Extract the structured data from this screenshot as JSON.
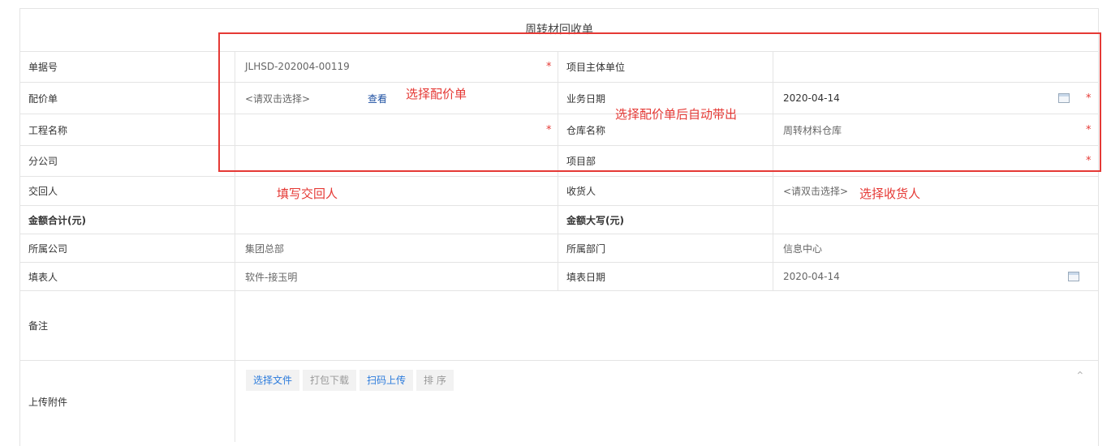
{
  "form_title": "周转材回收单",
  "rows": {
    "r1": {
      "l1": "单据号",
      "v1": "JLHSD-202004-00119",
      "l2": "项目主体单位",
      "v2": ""
    },
    "r2": {
      "l1": "配价单",
      "v1": "<请双击选择>",
      "link": "查看",
      "l2": "业务日期",
      "v2": "2020-04-14"
    },
    "r3": {
      "l1": "工程名称",
      "v1": "",
      "l2": "仓库名称",
      "v2": "周转材料仓库"
    },
    "r4": {
      "l1": "分公司",
      "v1": "",
      "l2": "项目部",
      "v2": ""
    },
    "r5": {
      "l1": "交回人",
      "v1": "",
      "l2": "收货人",
      "v2": "<请双击选择>"
    },
    "r6": {
      "l1": "金额合计(元)",
      "v1": "",
      "l2": "金额大写(元)",
      "v2": ""
    },
    "r7": {
      "l1": "所属公司",
      "v1": "集团总部",
      "l2": "所属部门",
      "v2": "信息中心"
    },
    "r8": {
      "l1": "填表人",
      "v1": "软件-接玉明",
      "l2": "填表日期",
      "v2": "2020-04-14"
    },
    "r9": {
      "l1": "备注"
    },
    "r10": {
      "l1": "上传附件"
    }
  },
  "required_mark": "*",
  "attachment_buttons": [
    "选择文件",
    "打包下载",
    "扫码上传",
    "排 序"
  ],
  "annotations": {
    "a1": "选择配价单",
    "a2": "选择配价单后自动带出",
    "a3": "填写交回人",
    "a4": "选择收货人"
  },
  "colors": {
    "annotation": "#e53935",
    "link": "#1e50a2",
    "button_text": "#2b7bdc"
  }
}
